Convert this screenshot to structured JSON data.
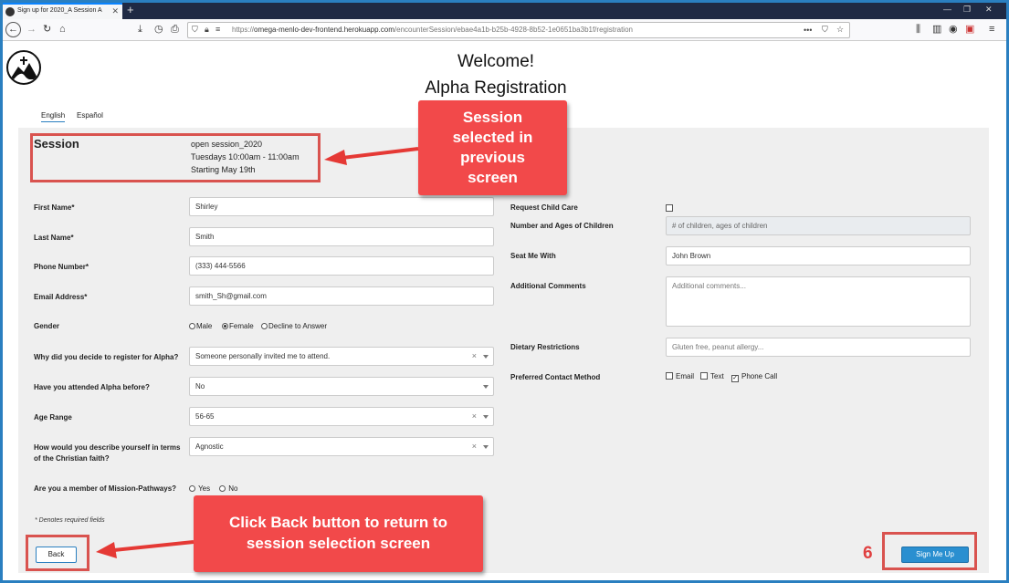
{
  "browser": {
    "tab_title": "Sign up for 2020_A Session A",
    "tab_close": "✕",
    "new_tab": "+",
    "url_prefix": "https://",
    "url_host": "omega-menlo-dev-frontend.herokuapp.com",
    "url_path": "/encounterSession/ebae4a1b-b25b-4928-8b52-1e0651ba3b1f/registration",
    "menu_dots": "•••"
  },
  "header": {
    "welcome": "Welcome!",
    "title": "Alpha Registration",
    "languages": [
      "English",
      "Español"
    ]
  },
  "session": {
    "label": "Session",
    "name": "open session_2020",
    "schedule": "Tuesdays 10:00am - 11:00am",
    "start": "Starting May 19th"
  },
  "form_left": {
    "first_name": {
      "label": "First Name*",
      "value": "Shirley"
    },
    "last_name": {
      "label": "Last Name*",
      "value": "Smith"
    },
    "phone": {
      "label": "Phone Number*",
      "value": "(333) 444-5566"
    },
    "email": {
      "label": "Email Address*",
      "value": "smith_Sh@gmail.com"
    },
    "gender": {
      "label": "Gender",
      "options": [
        "Male",
        "Female",
        "Decline to Answer"
      ],
      "selected": "Female"
    },
    "why": {
      "label": "Why did you decide to register for Alpha?",
      "value": "Someone personally invited me to attend."
    },
    "attended": {
      "label": "Have you attended Alpha before?",
      "value": "No"
    },
    "age": {
      "label": "Age Range",
      "value": "56-65"
    },
    "faith": {
      "label_line1": "How would you describe yourself in terms",
      "label_line2": "of the Christian faith?",
      "value": "Agnostic"
    },
    "member": {
      "label": "Are you a member of Mission-Pathways?",
      "options": [
        "Yes",
        "No"
      ]
    },
    "required_note": "* Denotes required fields"
  },
  "form_right": {
    "child_care": {
      "label": "Request Child Care"
    },
    "children": {
      "label": "Number and Ages of Children",
      "placeholder": "# of children, ages of children"
    },
    "seat_with": {
      "label": "Seat Me With",
      "value": "John Brown"
    },
    "comments": {
      "label": "Additional Comments",
      "placeholder": "Additional comments..."
    },
    "dietary": {
      "label": "Dietary Restrictions",
      "placeholder": "Gluten free, peanut allergy..."
    },
    "contact": {
      "label": "Preferred Contact Method",
      "options": [
        {
          "label": "Email",
          "checked": false
        },
        {
          "label": "Text",
          "checked": false
        },
        {
          "label": "Phone Call",
          "checked": true
        }
      ]
    }
  },
  "buttons": {
    "back": "Back",
    "sign_up": "Sign Me Up"
  },
  "annotations": {
    "session_callout": [
      "Session",
      "selected in",
      "previous",
      "screen"
    ],
    "back_callout": [
      "Click Back button to return to",
      "session selection screen"
    ],
    "step_number": "6",
    "callout_color": "#f2494a",
    "highlight_color": "#d9534f"
  }
}
